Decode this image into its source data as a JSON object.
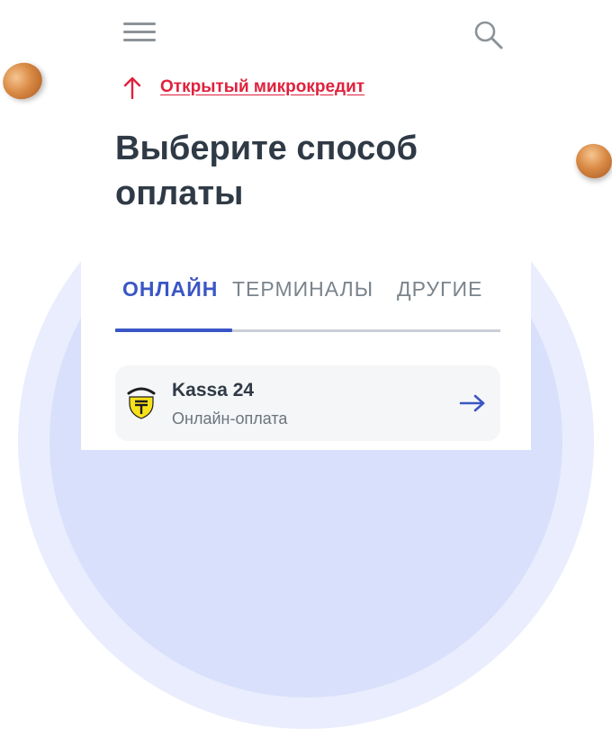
{
  "header": {
    "menu_icon": "hamburger-menu-icon",
    "search_icon": "search-icon"
  },
  "credit_link": {
    "icon": "arrow-up-icon",
    "label": "Открытый микрокредит",
    "color": "#e0213c"
  },
  "page_title": "Выберите способ оплаты",
  "tabs": [
    {
      "label": "ОНЛАЙН",
      "active": true
    },
    {
      "label": "ТЕРМИНАЛЫ",
      "active": false
    },
    {
      "label": "ДРУГИЕ",
      "active": false
    }
  ],
  "payment_methods": [
    {
      "title": "Kassa 24",
      "subtitle": "Онлайн-оплата",
      "logo": "kassa24-logo",
      "action_icon": "arrow-right-icon"
    }
  ],
  "colors": {
    "accent": "#3a56c5",
    "link": "#e0213c",
    "title": "#2f3a46",
    "logo_yellow": "#f7e11b"
  }
}
